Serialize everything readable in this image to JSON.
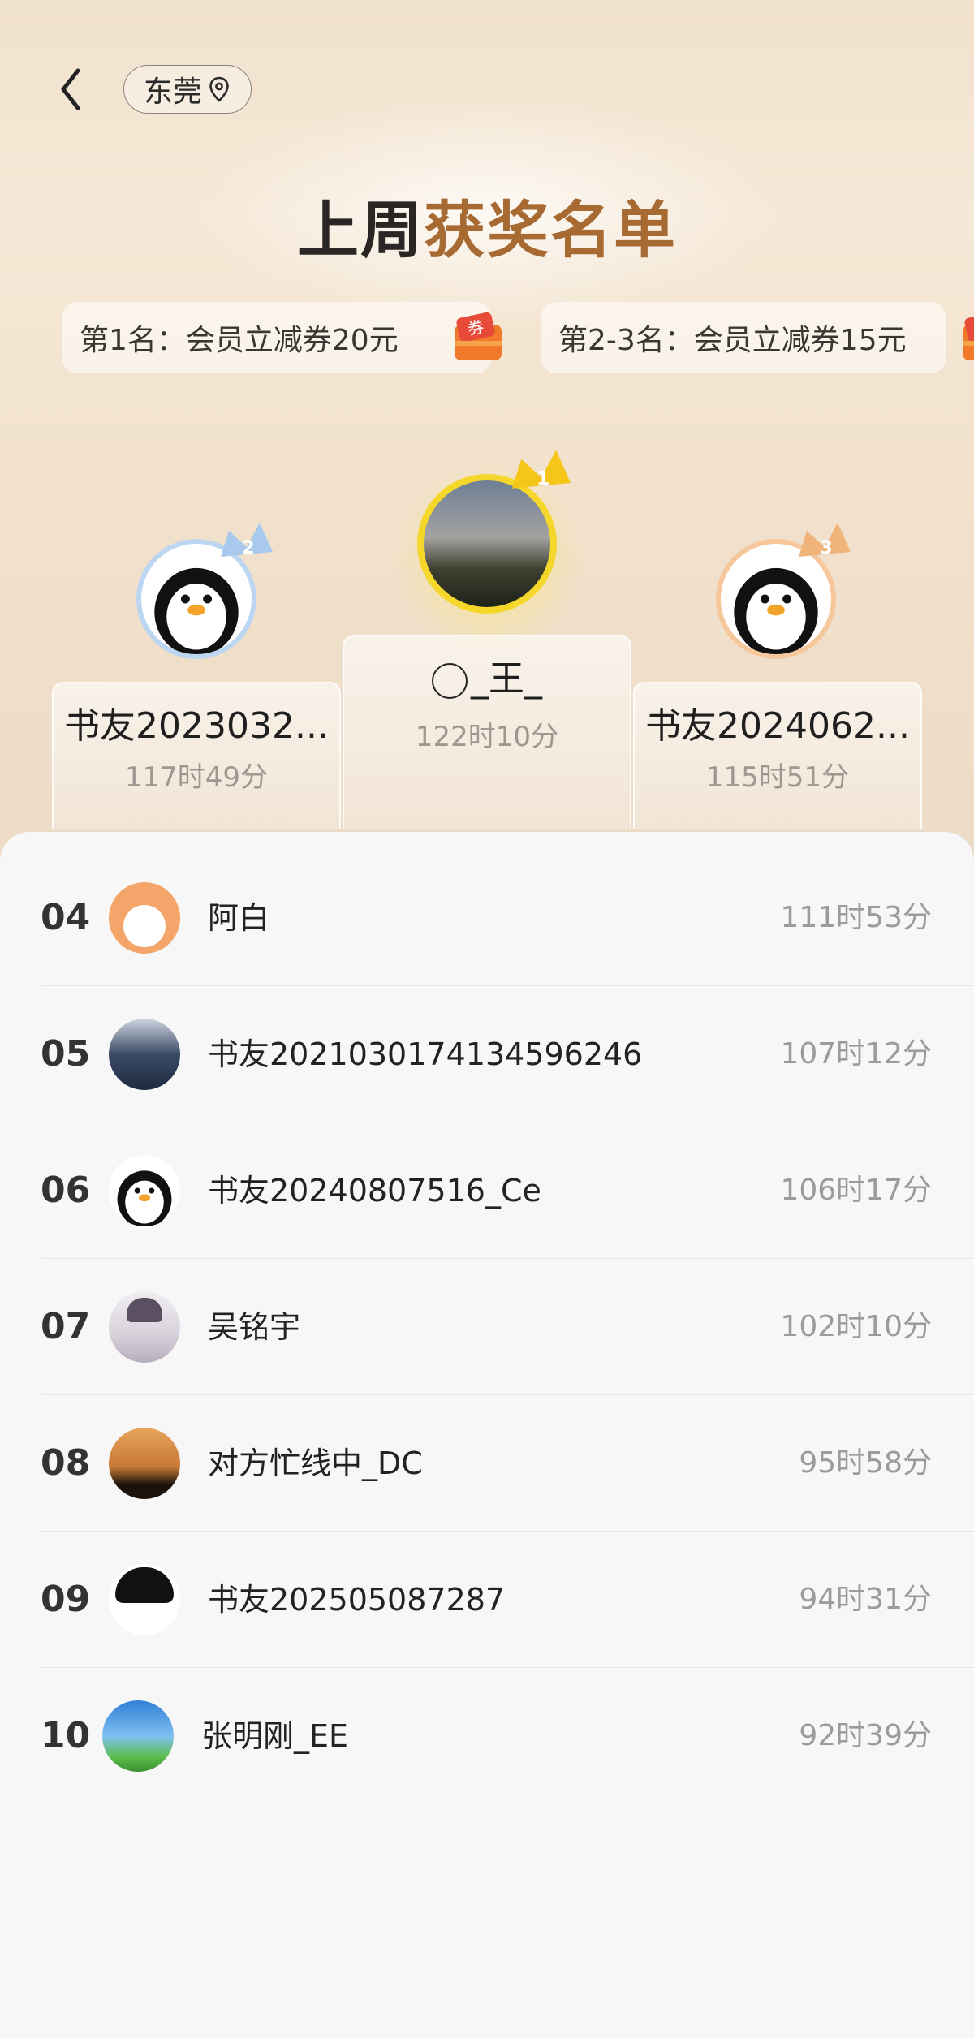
{
  "header": {
    "city": "东莞",
    "title_part1": "上周",
    "title_part2": "获奖名单"
  },
  "prizes": [
    {
      "label": "第1名：会员立减券20元",
      "icon": "coupon-icon",
      "icon_text": "券"
    },
    {
      "label": "第2-3名：会员立减券15元",
      "icon": "coupon-icon"
    }
  ],
  "podium": [
    {
      "rank": "2",
      "name": "书友2023032...",
      "time": "117时49分"
    },
    {
      "rank": "1",
      "name": "_王_",
      "time": "122时10分"
    },
    {
      "rank": "3",
      "name": "书友2024062...",
      "time": "115时51分"
    }
  ],
  "list": [
    {
      "rank": "04",
      "name": "阿白",
      "time": "111时53分"
    },
    {
      "rank": "05",
      "name": "书友2021030174134596246",
      "time": "107时12分"
    },
    {
      "rank": "06",
      "name": "书友20240807516_Ce",
      "time": "106时17分"
    },
    {
      "rank": "07",
      "name": "吴铭宇",
      "time": "102时10分"
    },
    {
      "rank": "08",
      "name": "对方忙线中_DC",
      "time": "95时58分"
    },
    {
      "rank": "09",
      "name": "书友202505087287",
      "time": "94时31分"
    },
    {
      "rank": "10",
      "name": "张明刚_EE",
      "time": "92时39分"
    }
  ],
  "colors": {
    "gold": "#f5c518",
    "silver": "#a9c9ec",
    "bronze": "#f0b37a",
    "title_accent": "#a86a33"
  }
}
